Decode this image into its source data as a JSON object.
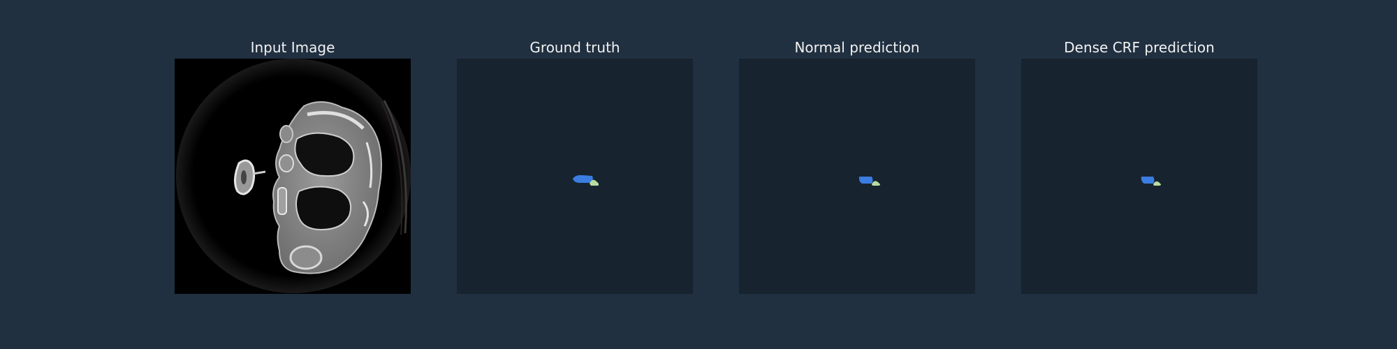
{
  "panels": [
    {
      "title": "Input Image"
    },
    {
      "title": "Ground truth"
    },
    {
      "title": "Normal prediction"
    },
    {
      "title": "Dense CRF prediction"
    }
  ],
  "colors": {
    "figure_background": "#203040",
    "mask_background": "#17232f",
    "class_1": "#3b7de0",
    "class_2": "#b8dca0",
    "ct_background": "#000000"
  }
}
